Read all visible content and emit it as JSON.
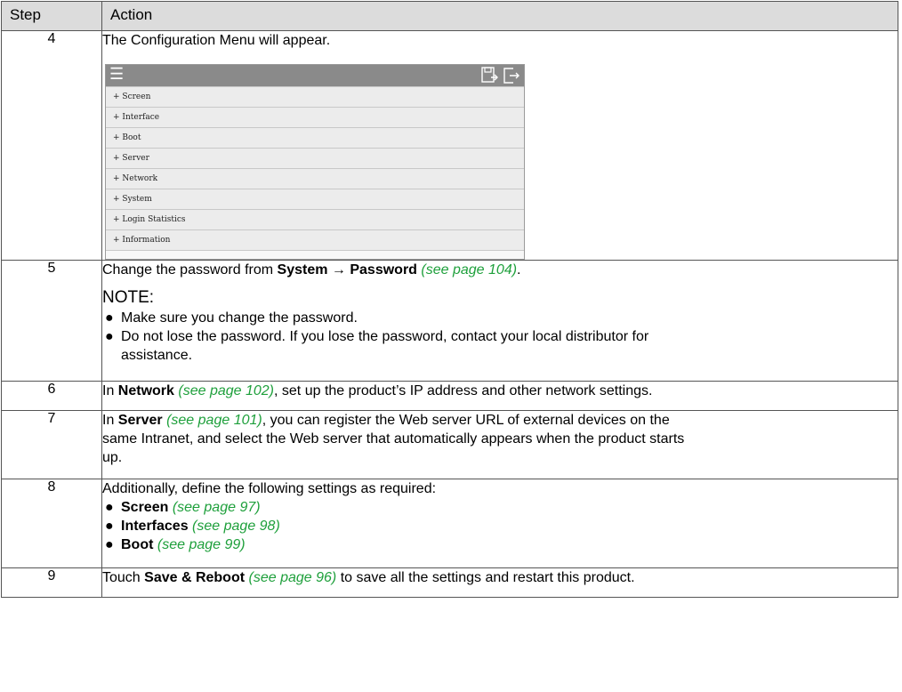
{
  "headers": {
    "step": "Step",
    "action": "Action"
  },
  "row4": {
    "step": "4",
    "text": "The Configuration Menu will appear.",
    "menu_items": [
      "+ Screen",
      "+ Interface",
      "+ Boot",
      "+ Server",
      "+ Network",
      "+ System",
      "+ Login Statistics",
      "+ Information"
    ],
    "icons": [
      "menu-icon",
      "save-icon",
      "exit-icon"
    ]
  },
  "row5": {
    "step": "5",
    "pre": "Change the password from ",
    "system": "System",
    "arrow": " → ",
    "password": "Password",
    "link": "(see page 104)",
    "post": ".",
    "note_title": "NOTE:",
    "bullets": [
      "Make sure you change the password.",
      "Do not lose the password. If you lose the password, contact your local distributor for",
      "assistance."
    ]
  },
  "row6": {
    "step": "6",
    "pre": "In ",
    "bold": "Network",
    "link": "(see page 102)",
    "post": ", set up the product’s IP address and other network settings."
  },
  "row7": {
    "step": "7",
    "pre": "In ",
    "bold": "Server",
    "link": "(see page 101)",
    "post_line1": ", you can register the Web server URL of external devices on the",
    "line2": "same Intranet, and select the Web server that automatically appears when the product starts",
    "line3": "up."
  },
  "row8": {
    "step": "8",
    "text": "Additionally, define the following settings as required:",
    "items": [
      {
        "bold": "Screen",
        "link": "(see page 97)"
      },
      {
        "bold": "Interfaces",
        "link": "(see page 98)"
      },
      {
        "bold": "Boot",
        "link": "(see page 99)"
      }
    ]
  },
  "row9": {
    "step": "9",
    "pre": "Touch ",
    "bold": "Save & Reboot",
    "link": "(see page 96)",
    "post": " to save all the settings and restart this product."
  },
  "colors": {
    "header_bg": "#dcdcdc",
    "link": "#1fa03c",
    "menu_bar": "#8a8a8a",
    "menu_row": "#ececec"
  }
}
